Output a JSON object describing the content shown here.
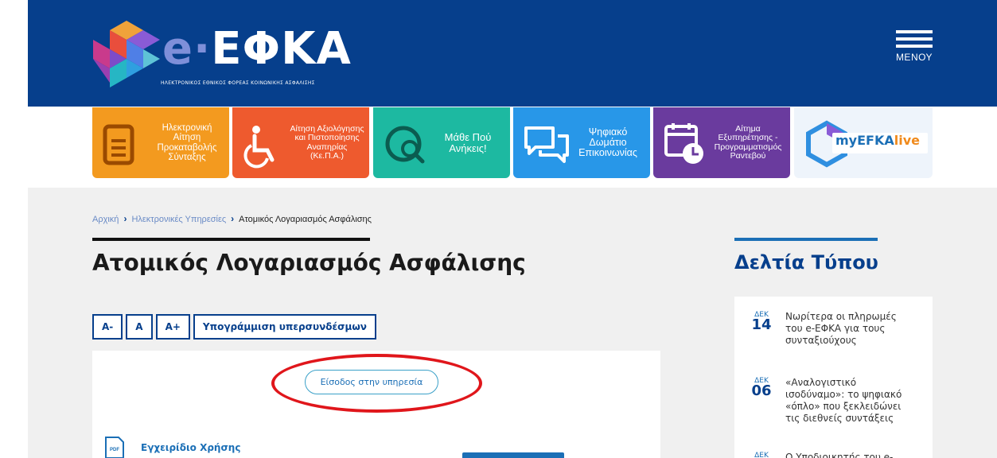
{
  "colors": {
    "header_bg": "#063f8c",
    "accent_blue": "#1b6fb6",
    "highlight_red": "#e0161b",
    "tile_orange": "#f39a1f",
    "tile_red": "#ee5a2e",
    "tile_teal": "#1db9a1",
    "tile_blue": "#2897e8",
    "tile_purple": "#6a3b9e",
    "tile_light": "#eef4fb"
  },
  "header": {
    "logo_prefix": "e·",
    "logo_name": "ΕΦΚΑ",
    "logo_subtitle": "ΗΛΕΚΤΡΟΝΙΚΟΣ ΕΘΝΙΚΟΣ ΦΟΡΕΑΣ ΚΟΙΝΩΝΙΚΗΣ ΑΣΦΑΛΙΣΗΣ",
    "menu_label": "ΜΕΝΟΥ",
    "menu_icon": "hamburger-icon"
  },
  "tiles": [
    {
      "label": "Ηλεκτρονική Αίτηση Προκαταβολής Σύνταξης",
      "icon": "document-icon",
      "color": "#f39a1f"
    },
    {
      "label": "Αίτηση Αξιολόγησης και Πιστοποίησης Αναπηρίας (Κε.Π.Α.)",
      "icon": "wheelchair-icon",
      "color": "#ee5a2e"
    },
    {
      "label": "Μάθε Πού Ανήκεις!",
      "icon": "globe-search-icon",
      "color": "#1db9a1"
    },
    {
      "label": "Ψηφιακό Δωμάτιο Επικοινωνίας",
      "icon": "chat-icon",
      "color": "#2897e8"
    },
    {
      "label": "Αίτημα Εξυπηρέτησης - Προγραμματισμός Ραντεβού",
      "icon": "calendar-clock-icon",
      "color": "#6a3b9e"
    },
    {
      "label_main": "myEFKA",
      "label_suffix": "live",
      "icon": "hexagon-icon",
      "color": "#eef4fb"
    }
  ],
  "breadcrumb": {
    "home": "Αρχική",
    "section": "Ηλεκτρονικές Υπηρεσίες",
    "current": "Ατομικός Λογαριασμός Ασφάλισης"
  },
  "main": {
    "title": "Ατομικός Λογαριασμός Ασφάλισης",
    "tools": {
      "decrease": "A-",
      "normal": "A",
      "increase": "A+",
      "underline_links": "Υπογράμμιση υπερσυνδέσμων"
    },
    "login_button": "Είσοδος στην υπηρεσία",
    "manual_link": "Εγχειρίδιο Χρήσης",
    "manual_icon_label": "PDF"
  },
  "sidebar": {
    "title": "Δελτία Τύπου",
    "news": [
      {
        "month": "ΔΕΚ",
        "day": "14",
        "text": "Νωρίτερα οι πληρωμές του e-ΕΦΚΑ για τους συνταξιούχους"
      },
      {
        "month": "ΔΕΚ",
        "day": "06",
        "text": "«Αναλογιστικό ισοδύναμο»: το ψηφιακό «όπλο» που ξεκλειδώνει τις διεθνείς συντάξεις"
      },
      {
        "month": "ΔΕΚ",
        "day": "",
        "text": "Ο Υποδιοικητής του e-"
      }
    ]
  }
}
